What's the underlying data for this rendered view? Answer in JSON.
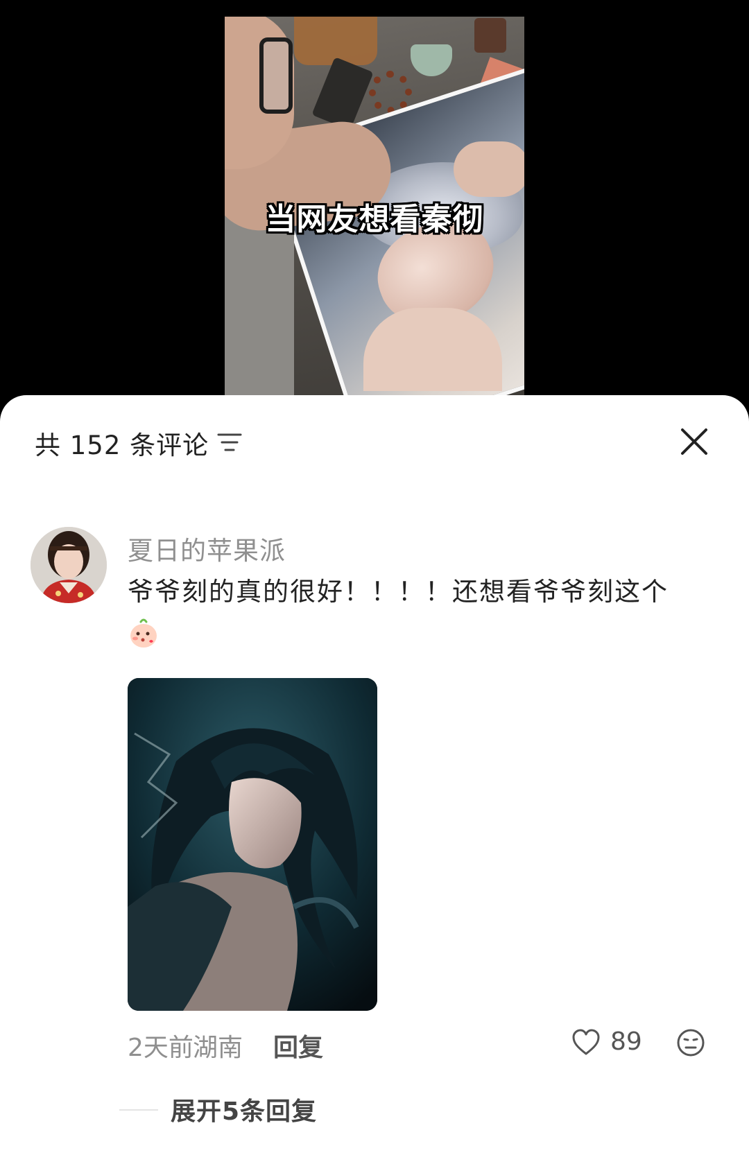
{
  "video": {
    "caption": "当网友想看秦彻"
  },
  "comments_panel": {
    "header": {
      "count_label": "共 152 条评论",
      "sort_icon": "filter-lines-icon",
      "close_icon": "close-icon"
    },
    "comment": {
      "username": "夏日的苹果派",
      "text": "爷爷刻的真的很好！！！！还想看爷爷刻这个",
      "emoji": "blush-face-emoji",
      "time": "2天前",
      "location": "湖南",
      "reply_label": "回复",
      "like_count": "89",
      "like_icon": "heart-outline-icon",
      "dislike_icon": "neutral-face-icon"
    },
    "expand_label": "展开5条回复"
  },
  "colors": {
    "sheet_bg": "#ffffff",
    "primary_text": "#222222",
    "secondary_text": "#8f8f8f"
  }
}
